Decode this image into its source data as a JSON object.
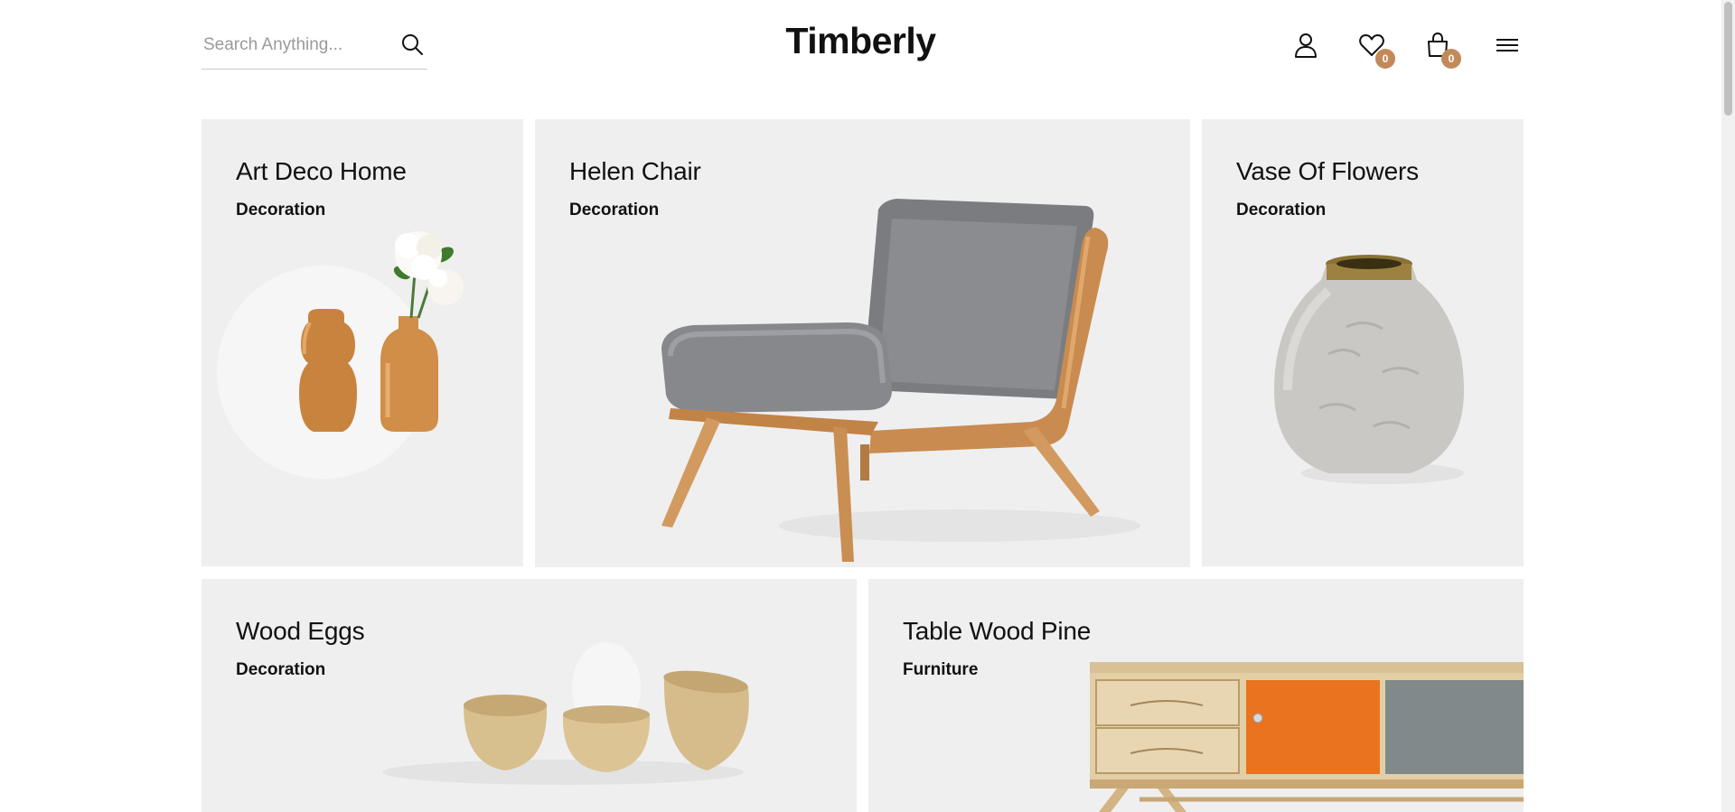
{
  "header": {
    "search_placeholder": "Search Anything...",
    "logo": "Timberly",
    "wishlist_count": "0",
    "cart_count": "0"
  },
  "products": [
    {
      "title": "Art Deco Home",
      "category": "Decoration"
    },
    {
      "title": "Helen Chair",
      "category": "Decoration"
    },
    {
      "title": "Vase Of Flowers",
      "category": "Decoration"
    },
    {
      "title": "Wood Eggs",
      "category": "Decoration"
    },
    {
      "title": "Table Wood Pine",
      "category": "Furniture"
    }
  ],
  "icons": [
    "search-icon",
    "user-icon",
    "heart-icon",
    "cart-icon",
    "menu-icon"
  ],
  "colors": {
    "accent": "#c28a5a",
    "card_bg": "#efeff0"
  }
}
